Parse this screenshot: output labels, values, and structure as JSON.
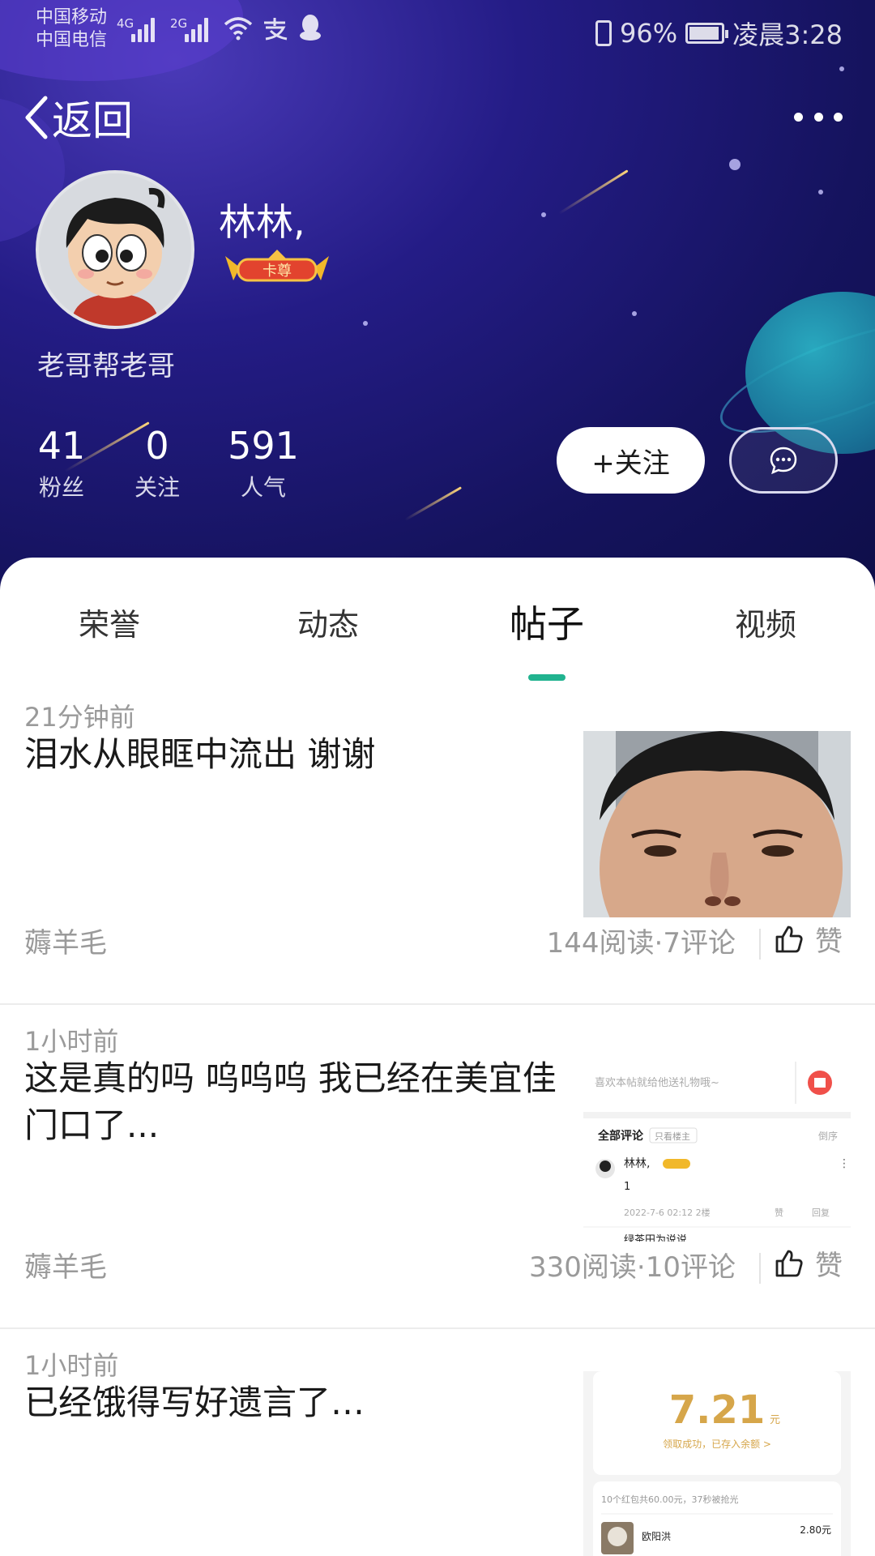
{
  "status_bar": {
    "carrier1": "中国移动",
    "carrier2": "中国电信",
    "net1": "4G",
    "net2": "2G",
    "battery": "96%",
    "time": "凌晨3:28"
  },
  "nav": {
    "back_label": "返回",
    "more_icon": "more-dots-icon"
  },
  "profile": {
    "nickname": "林林,",
    "badge_text": "卡尊",
    "group_name": "老哥帮老哥",
    "stats": [
      {
        "value": "41",
        "label": "粉丝"
      },
      {
        "value": "0",
        "label": "关注"
      },
      {
        "value": "591",
        "label": "人气"
      }
    ],
    "follow_label": "+关注",
    "message_icon": "chat-bubble-icon"
  },
  "tabs": [
    {
      "label": "荣誉",
      "active": false
    },
    {
      "label": "动态",
      "active": false
    },
    {
      "label": "帖子",
      "active": true
    },
    {
      "label": "视频",
      "active": false
    }
  ],
  "posts": [
    {
      "time": "21分钟前",
      "title": "泪水从眼眶中流出 谢谢",
      "category": "薅羊毛",
      "meta": "144阅读·7评论",
      "like_label": "赞"
    },
    {
      "time": "1小时前",
      "title": "这是真的吗 呜呜呜 我已经在美宜佳门口了...",
      "category": "薅羊毛",
      "meta": "330阅读·10评论",
      "like_label": "赞",
      "thumb": {
        "gift_text": "喜欢本帖就给他送礼物哦~",
        "all_comments": "全部评论",
        "only_op": "只看楼主",
        "sort": "倒序",
        "commenter": "林林,",
        "comment_text": "1",
        "comment_date": "2022-7-6 02:12 2楼",
        "like": "赞",
        "reply": "回复",
        "next_commenter": "绿茶田为说说"
      }
    },
    {
      "time": "1小时前",
      "title": "已经饿得写好遗言了…",
      "category": "",
      "meta": "",
      "like_label": "",
      "thumb": {
        "amount": "7.21",
        "unit": "元",
        "claim_text": "领取成功，已存入余额 >",
        "summary": "10个红包共60.00元，37秒被抢光",
        "winner": "欧阳洪",
        "winner_amount": "2.80元"
      }
    }
  ]
}
